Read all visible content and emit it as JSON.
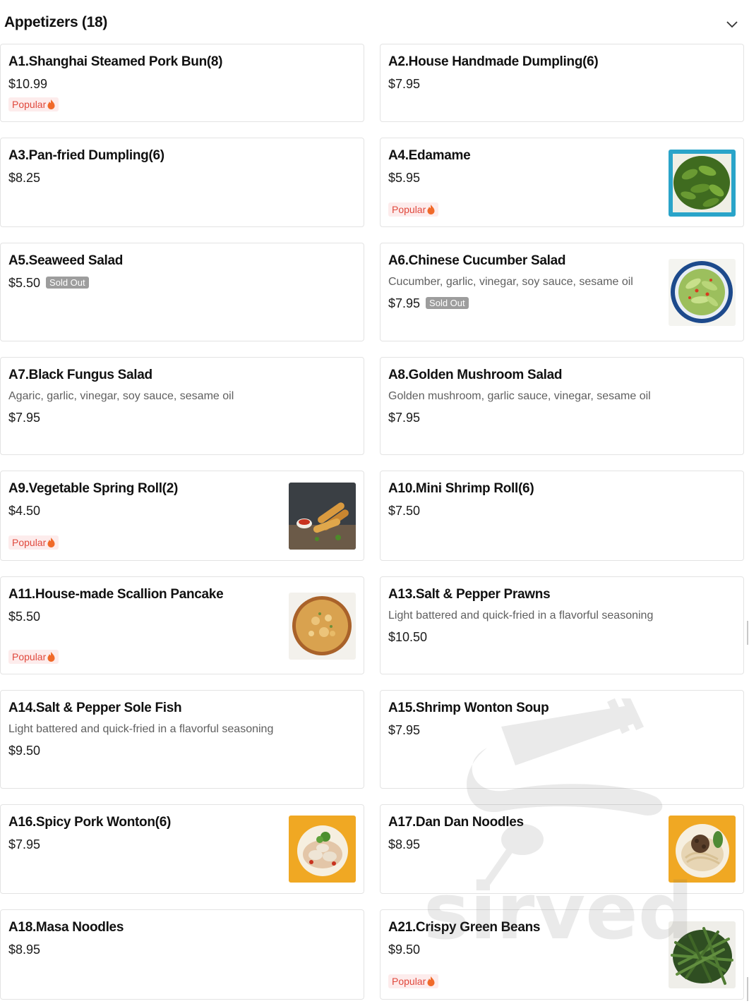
{
  "section": {
    "title": "Appetizers (18)"
  },
  "badges": {
    "popular": "Popular",
    "sold_out": "Sold Out"
  },
  "items": [
    {
      "name": "A1.Shanghai Steamed Pork Bun(8)",
      "price": "$10.99",
      "popular": true
    },
    {
      "name": "A2.House Handmade Dumpling(6)",
      "price": "$7.95"
    },
    {
      "name": "A3.Pan-fried Dumpling(6)",
      "price": "$8.25"
    },
    {
      "name": "A4.Edamame",
      "price": "$5.95",
      "popular": true,
      "image": "edamame-image"
    },
    {
      "name": "A5.Seaweed Salad",
      "price": "$5.50",
      "sold_out": true
    },
    {
      "name": "A6.Chinese Cucumber Salad",
      "description": "Cucumber, garlic, vinegar, soy sauce, sesame oil",
      "price": "$7.95",
      "sold_out": true,
      "image": "cucumber-salad-image"
    },
    {
      "name": "A7.Black Fungus Salad",
      "description": "Agaric, garlic, vinegar, soy sauce, sesame oil",
      "price": "$7.95"
    },
    {
      "name": "A8.Golden Mushroom Salad",
      "description": "Golden mushroom, garlic sauce, vinegar, sesame oil",
      "price": "$7.95"
    },
    {
      "name": "A9.Vegetable Spring Roll(2)",
      "price": "$4.50",
      "popular": true,
      "image": "spring-roll-image"
    },
    {
      "name": "A10.Mini Shrimp Roll(6)",
      "price": "$7.50"
    },
    {
      "name": "A11.House-made Scallion Pancake",
      "price": "$5.50",
      "popular": true,
      "image": "scallion-pancake-image"
    },
    {
      "name": "A13.Salt & Pepper Prawns",
      "description": "Light battered and quick-fried in a flavorful seasoning",
      "price": "$10.50"
    },
    {
      "name": "A14.Salt & Pepper Sole Fish",
      "description": "Light battered and quick-fried in a flavorful seasoning",
      "price": "$9.50"
    },
    {
      "name": "A15.Shrimp Wonton Soup",
      "price": "$7.95"
    },
    {
      "name": "A16.Spicy Pork Wonton(6)",
      "price": "$7.95",
      "image": "pork-wonton-image"
    },
    {
      "name": "A17.Dan Dan Noodles",
      "price": "$8.95",
      "image": "dan-dan-noodles-image"
    },
    {
      "name": "A18.Masa Noodles",
      "price": "$8.95"
    },
    {
      "name": "A21.Crispy Green Beans",
      "price": "$9.50",
      "popular": true,
      "image": "green-beans-image"
    }
  ],
  "colors": {
    "popular_text": "#e0493d",
    "popular_bg": "#fdecec",
    "sold_out_bg": "#9d9d9d",
    "card_border": "#e3e3e3"
  },
  "watermark": {
    "brand": "sirved",
    "icon": "fork-spoon-icon"
  }
}
